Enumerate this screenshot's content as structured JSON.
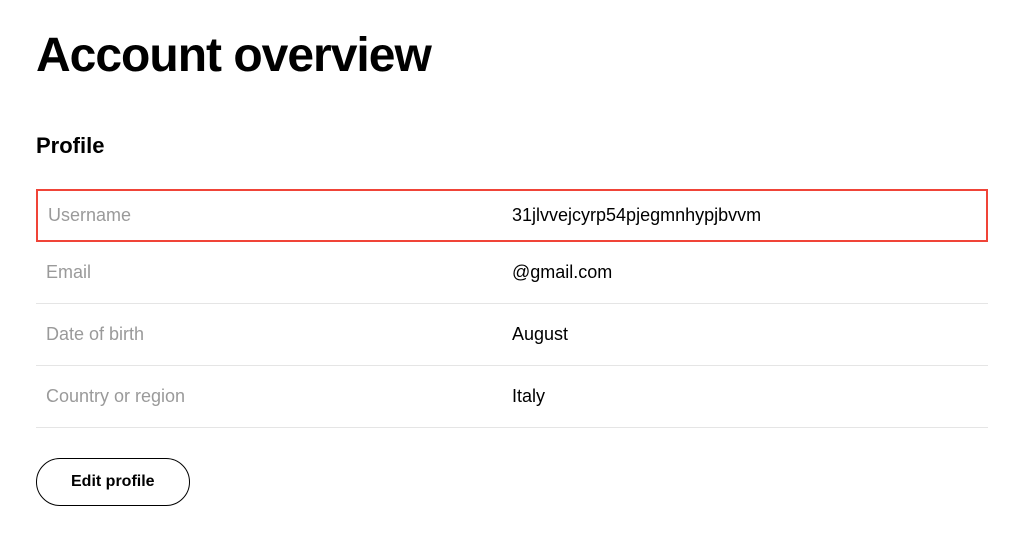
{
  "page_title": "Account overview",
  "section_title": "Profile",
  "rows": [
    {
      "label": "Username",
      "value": "31jlvvejcyrp54pjegmnhypjbvvm",
      "highlighted": true
    },
    {
      "label": "Email",
      "value": "@gmail.com",
      "highlighted": false
    },
    {
      "label": "Date of birth",
      "value": "August",
      "highlighted": false
    },
    {
      "label": "Country or region",
      "value": "Italy",
      "highlighted": false
    }
  ],
  "edit_button_label": "Edit profile"
}
